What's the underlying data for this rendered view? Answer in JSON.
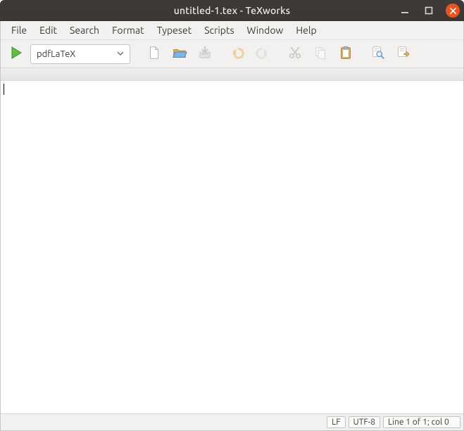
{
  "titlebar": {
    "title": "untitled-1.tex - TeXworks"
  },
  "menu": {
    "items": [
      "File",
      "Edit",
      "Search",
      "Format",
      "Typeset",
      "Scripts",
      "Window",
      "Help"
    ]
  },
  "toolbar": {
    "engine_selected": "pdfLaTeX"
  },
  "statusbar": {
    "line_ending": "LF",
    "encoding": "UTF-8",
    "position": "Line 1 of 1; col 0"
  }
}
